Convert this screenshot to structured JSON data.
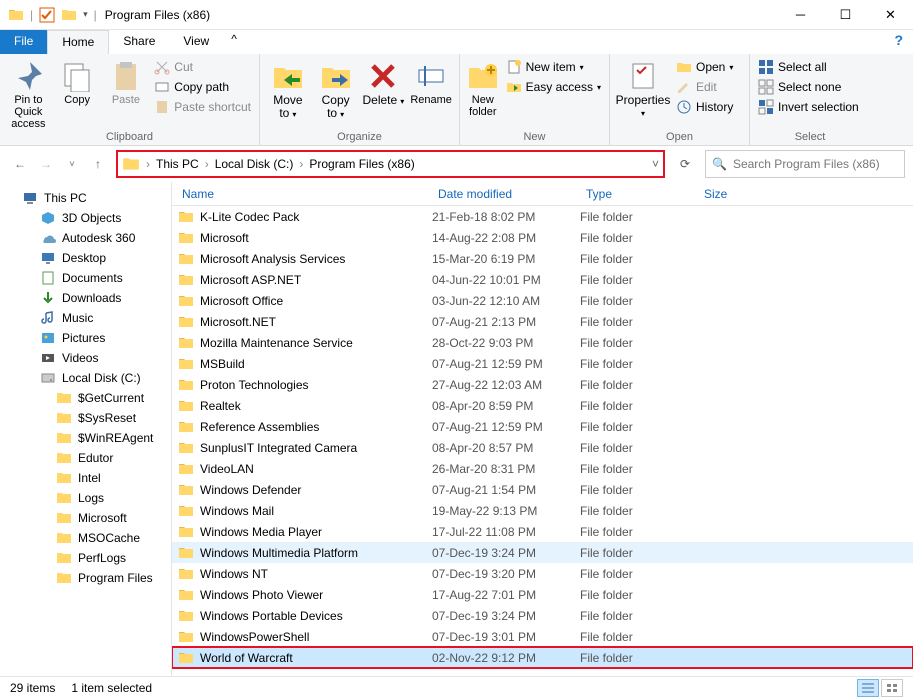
{
  "window": {
    "title": "Program Files (x86)"
  },
  "tabs": {
    "file": "File",
    "home": "Home",
    "share": "Share",
    "view": "View"
  },
  "ribbon": {
    "clipboard": {
      "label": "Clipboard",
      "pin": "Pin to Quick\naccess",
      "copy": "Copy",
      "paste": "Paste",
      "cut": "Cut",
      "copy_path": "Copy path",
      "paste_shortcut": "Paste shortcut"
    },
    "organize": {
      "label": "Organize",
      "move_to": "Move\nto",
      "copy_to": "Copy\nto",
      "delete": "Delete",
      "rename": "Rename"
    },
    "new": {
      "label": "New",
      "new_folder": "New\nfolder",
      "new_item": "New item",
      "easy_access": "Easy access"
    },
    "open": {
      "label": "Open",
      "properties": "Properties",
      "open": "Open",
      "edit": "Edit",
      "history": "History"
    },
    "select": {
      "label": "Select",
      "select_all": "Select all",
      "select_none": "Select none",
      "invert": "Invert selection"
    }
  },
  "breadcrumb": {
    "parts": [
      "This PC",
      "Local Disk (C:)",
      "Program Files (x86)"
    ]
  },
  "search": {
    "placeholder": "Search Program Files (x86)"
  },
  "columns": {
    "name": "Name",
    "date": "Date modified",
    "type": "Type",
    "size": "Size"
  },
  "sidebar": [
    {
      "label": "This PC",
      "icon": "pc",
      "indent": 0
    },
    {
      "label": "3D Objects",
      "icon": "3d",
      "indent": 1
    },
    {
      "label": "Autodesk 360",
      "icon": "cloud",
      "indent": 1
    },
    {
      "label": "Desktop",
      "icon": "desktop",
      "indent": 1
    },
    {
      "label": "Documents",
      "icon": "docs",
      "indent": 1
    },
    {
      "label": "Downloads",
      "icon": "down",
      "indent": 1
    },
    {
      "label": "Music",
      "icon": "music",
      "indent": 1
    },
    {
      "label": "Pictures",
      "icon": "pics",
      "indent": 1
    },
    {
      "label": "Videos",
      "icon": "video",
      "indent": 1
    },
    {
      "label": "Local Disk (C:)",
      "icon": "disk",
      "indent": 1
    },
    {
      "label": "$GetCurrent",
      "icon": "folder",
      "indent": 2
    },
    {
      "label": "$SysReset",
      "icon": "folder",
      "indent": 2
    },
    {
      "label": "$WinREAgent",
      "icon": "folder",
      "indent": 2
    },
    {
      "label": "Edutor",
      "icon": "folder",
      "indent": 2
    },
    {
      "label": "Intel",
      "icon": "folder",
      "indent": 2
    },
    {
      "label": "Logs",
      "icon": "folder",
      "indent": 2
    },
    {
      "label": "Microsoft",
      "icon": "folder",
      "indent": 2
    },
    {
      "label": "MSOCache",
      "icon": "folder",
      "indent": 2
    },
    {
      "label": "PerfLogs",
      "icon": "folder",
      "indent": 2
    },
    {
      "label": "Program Files",
      "icon": "folder",
      "indent": 2
    }
  ],
  "files": [
    {
      "name": "K-Lite Codec Pack",
      "date": "21-Feb-18 8:02 PM",
      "type": "File folder"
    },
    {
      "name": "Microsoft",
      "date": "14-Aug-22 2:08 PM",
      "type": "File folder"
    },
    {
      "name": "Microsoft Analysis Services",
      "date": "15-Mar-20 6:19 PM",
      "type": "File folder"
    },
    {
      "name": "Microsoft ASP.NET",
      "date": "04-Jun-22 10:01 PM",
      "type": "File folder"
    },
    {
      "name": "Microsoft Office",
      "date": "03-Jun-22 12:10 AM",
      "type": "File folder"
    },
    {
      "name": "Microsoft.NET",
      "date": "07-Aug-21 2:13 PM",
      "type": "File folder"
    },
    {
      "name": "Mozilla Maintenance Service",
      "date": "28-Oct-22 9:03 PM",
      "type": "File folder"
    },
    {
      "name": "MSBuild",
      "date": "07-Aug-21 12:59 PM",
      "type": "File folder"
    },
    {
      "name": "Proton Technologies",
      "date": "27-Aug-22 12:03 AM",
      "type": "File folder"
    },
    {
      "name": "Realtek",
      "date": "08-Apr-20 8:59 PM",
      "type": "File folder"
    },
    {
      "name": "Reference Assemblies",
      "date": "07-Aug-21 12:59 PM",
      "type": "File folder"
    },
    {
      "name": "SunplusIT Integrated Camera",
      "date": "08-Apr-20 8:57 PM",
      "type": "File folder"
    },
    {
      "name": "VideoLAN",
      "date": "26-Mar-20 8:31 PM",
      "type": "File folder"
    },
    {
      "name": "Windows Defender",
      "date": "07-Aug-21 1:54 PM",
      "type": "File folder"
    },
    {
      "name": "Windows Mail",
      "date": "19-May-22 9:13 PM",
      "type": "File folder"
    },
    {
      "name": "Windows Media Player",
      "date": "17-Jul-22 11:08 PM",
      "type": "File folder"
    },
    {
      "name": "Windows Multimedia Platform",
      "date": "07-Dec-19 3:24 PM",
      "type": "File folder",
      "hover": true
    },
    {
      "name": "Windows NT",
      "date": "07-Dec-19 3:20 PM",
      "type": "File folder"
    },
    {
      "name": "Windows Photo Viewer",
      "date": "17-Aug-22 7:01 PM",
      "type": "File folder"
    },
    {
      "name": "Windows Portable Devices",
      "date": "07-Dec-19 3:24 PM",
      "type": "File folder"
    },
    {
      "name": "WindowsPowerShell",
      "date": "07-Dec-19 3:01 PM",
      "type": "File folder"
    },
    {
      "name": "World of Warcraft",
      "date": "02-Nov-22 9:12 PM",
      "type": "File folder",
      "selected": true
    }
  ],
  "status": {
    "count": "29 items",
    "selection": "1 item selected"
  }
}
